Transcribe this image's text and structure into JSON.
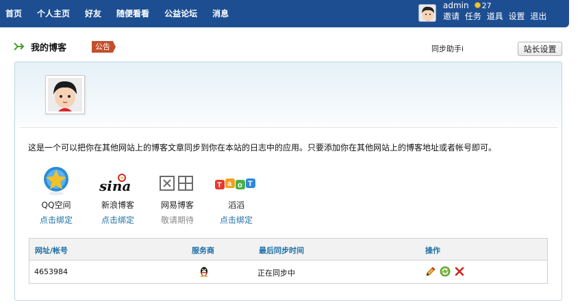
{
  "nav": {
    "items": [
      {
        "label": "首页"
      },
      {
        "label": "个人主页"
      },
      {
        "label": "好友"
      },
      {
        "label": "随便看看"
      },
      {
        "label": "公益论坛"
      },
      {
        "label": "消息"
      }
    ]
  },
  "user": {
    "name": "admin",
    "credits": "27",
    "links": [
      {
        "label": "邀请"
      },
      {
        "label": "任务"
      },
      {
        "label": "道具"
      },
      {
        "label": "设置"
      },
      {
        "label": "退出"
      }
    ]
  },
  "header": {
    "title": "我的博客",
    "notice": "公告",
    "sync_helper": "同步助手i",
    "admin_button": "站长设置"
  },
  "main": {
    "description": "这是一个可以把你在其他网站上的博客文章同步到你在本站的日志中的应用。只要添加你在其他网站上的博客地址或者帐号即可。",
    "services": [
      {
        "name": "QQ空间",
        "action": "点击绑定",
        "icon": "qzone-logo-icon"
      },
      {
        "name": "新浪博客",
        "action": "点击绑定",
        "icon": "sina-logo-icon"
      },
      {
        "name": "网易博客",
        "action": "敬请期待",
        "icon": "netease-logo-icon"
      },
      {
        "name": "滔滔",
        "action": "点击绑定",
        "icon": "taotao-logo-icon"
      }
    ],
    "table": {
      "headers": [
        "网址/帐号",
        "服务商",
        "最后同步时间",
        "操作"
      ],
      "rows": [
        {
          "account": "4653984",
          "provider_icon": "qq-penguin-icon",
          "status": "正在同步中"
        }
      ]
    }
  },
  "colors": {
    "topbar": "#1d4e92",
    "link": "#1d6fa5",
    "notice": "#c34f2c"
  }
}
